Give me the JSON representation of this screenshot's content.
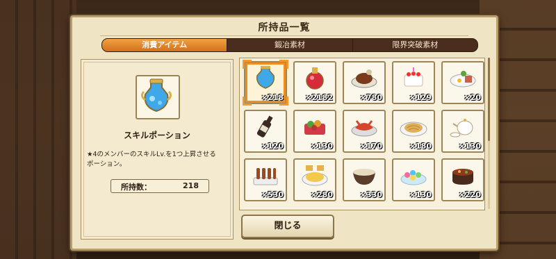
{
  "window": {
    "title": "所持品一覧"
  },
  "tabs": [
    {
      "label": "消費アイテム",
      "active": true
    },
    {
      "label": "鍛冶素材",
      "active": false
    },
    {
      "label": "限界突破素材",
      "active": false
    }
  ],
  "detail": {
    "icon": "skill-potion-icon",
    "name": "スキルポーション",
    "description_line1": "★4のメンバーのスキルLv.を1つ上昇させる",
    "description_line2": "ポーション。",
    "owned_label": "所持数：",
    "owned_value": "218"
  },
  "items": [
    {
      "icon": "skill-potion-icon",
      "count": "×218",
      "selected": true
    },
    {
      "icon": "red-potion-icon",
      "count": "×2182",
      "selected": false
    },
    {
      "icon": "roast-meat-icon",
      "count": "×780",
      "selected": false
    },
    {
      "icon": "birthday-cake-icon",
      "count": "×129",
      "selected": false
    },
    {
      "icon": "bacon-egg-icon",
      "count": "×20",
      "selected": false
    },
    {
      "icon": "wine-bottle-icon",
      "count": "×120",
      "selected": false
    },
    {
      "icon": "salad-bowl-icon",
      "count": "×130",
      "selected": false
    },
    {
      "icon": "lobster-dish-icon",
      "count": "×170",
      "selected": false
    },
    {
      "icon": "pasta-plate-icon",
      "count": "×180",
      "selected": false
    },
    {
      "icon": "tea-set-icon",
      "count": "×130",
      "selected": false
    },
    {
      "icon": "skewers-icon",
      "count": "×530",
      "selected": false
    },
    {
      "icon": "fried-rice-icon",
      "count": "×280",
      "selected": false
    },
    {
      "icon": "soup-bowl-icon",
      "count": "×330",
      "selected": false
    },
    {
      "icon": "colorful-sweets-icon",
      "count": "×130",
      "selected": false
    },
    {
      "icon": "stew-pot-icon",
      "count": "×220",
      "selected": false
    }
  ],
  "footer": {
    "close_label": "閉じる"
  },
  "colors": {
    "accent": "#ef8d25",
    "panel": "#efe4c4",
    "tab_bar": "#4a2d1c"
  }
}
